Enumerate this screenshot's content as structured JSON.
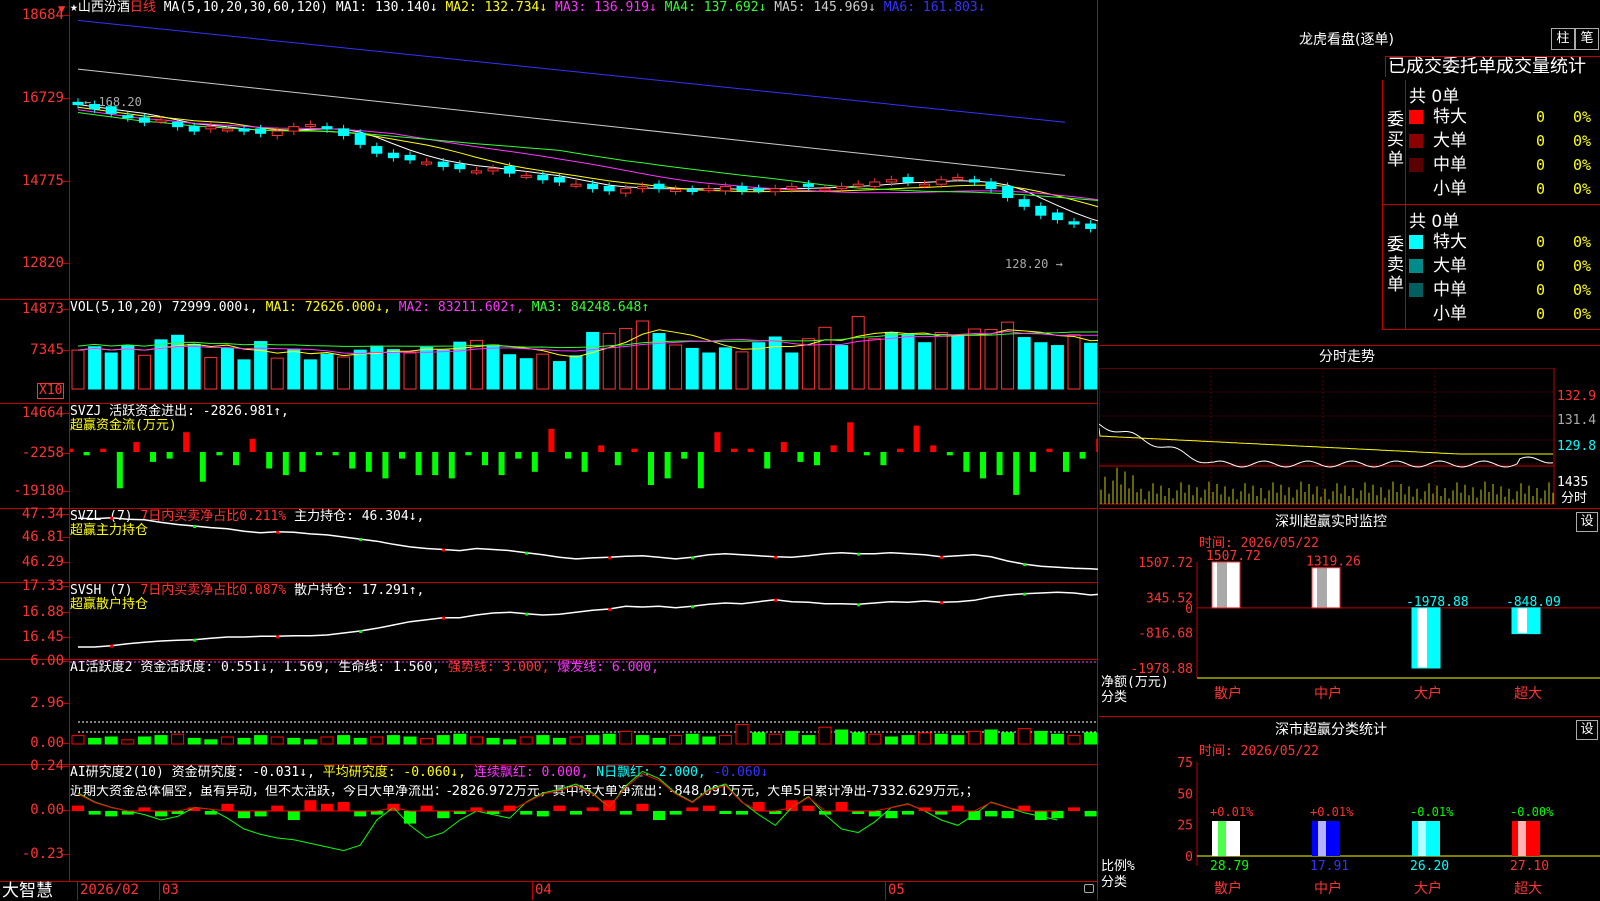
{
  "stock": {
    "name": "山西汾酒",
    "period": "日线",
    "ma_title": "MA(5,10,20,30,60,120)",
    "ma": [
      {
        "label": "MA1: 130.140↓",
        "color": "#ffffff"
      },
      {
        "label": "MA2: 132.734↓",
        "color": "#ffff00"
      },
      {
        "label": "MA3: 136.919↓",
        "color": "#ff33ff"
      },
      {
        "label": "MA4: 137.692↓",
        "color": "#33ff33"
      },
      {
        "label": "MA5: 145.969↓",
        "color": "#cccccc"
      },
      {
        "label": "MA6: 161.803↓",
        "color": "#3333ff"
      }
    ],
    "price_ticks": [
      "18684",
      "16729",
      "14775",
      "12820"
    ],
    "high_label": "168.20",
    "low_label": "128.20"
  },
  "vol": {
    "title": "VOL(5,10,20)",
    "value": "72999.000↓,",
    "ma": [
      {
        "label": "MA1: 72626.000↓,",
        "color": "#ffff00"
      },
      {
        "label": "MA2: 83211.602↑,",
        "color": "#ff33ff"
      },
      {
        "label": "MA3: 84248.648↑",
        "color": "#33ff33"
      }
    ],
    "ticks": [
      "14873",
      "7345"
    ],
    "unit": "X10",
    "values": [
      6.8,
      7.4,
      6.3,
      7.6,
      5.9,
      8.6,
      9.4,
      7.8,
      5.5,
      7.1,
      5.1,
      8.3,
      5.4,
      7.0,
      5.1,
      6.1,
      5.6,
      6.8,
      7.5,
      6.9,
      6.3,
      7.3,
      6.8,
      8.2,
      8.5,
      7.7,
      6.0,
      5.3,
      6.1,
      4.8,
      5.8,
      9.9,
      9.7,
      10.6,
      11.9,
      9.7,
      7.7,
      7.1,
      6.3,
      7.2,
      6.5,
      8.1,
      9.1,
      6.3,
      8.8,
      10.8,
      7.6,
      12.7,
      8.8,
      9.9,
      9.5,
      8.1,
      9.9,
      9.3,
      10.5,
      10.4,
      11.7,
      9.0,
      8.1,
      7.6,
      9.5,
      8.0,
      9.8,
      8.2
    ]
  },
  "svzj": {
    "title": "SVZJ  活跃资金进出: -2826.981↑,",
    "subtitle": "超赢资金流(万元)",
    "ticks": [
      "14664",
      "-2258",
      "-19180"
    ],
    "values": [
      1,
      -1,
      1,
      -11,
      3,
      -3,
      -2,
      6,
      -9,
      -1,
      -4,
      4,
      -5,
      -7,
      -6,
      -1,
      -1,
      -5,
      -6,
      -8,
      -2,
      -7,
      -7,
      -8,
      -1,
      -4,
      -7,
      -2,
      -6,
      7,
      -2,
      -6,
      2,
      -4,
      1,
      -10,
      -8,
      -2,
      -11,
      6,
      1,
      1,
      -5,
      3,
      -3,
      -4,
      2,
      9,
      -1,
      -4,
      1,
      8,
      2,
      -1,
      -6,
      -8,
      -7,
      -13,
      -6,
      1,
      -6,
      -2,
      4,
      -2,
      -2
    ]
  },
  "svzl": {
    "prefix": "SVZL (7)",
    "mid": "7日内买卖净占比0.211%",
    "tail": "主力持仓: 46.304↓,",
    "subtitle": "超赢主力持仓",
    "ticks": [
      "47.34",
      "46.81",
      "46.29"
    ],
    "values": [
      47.3,
      47.29,
      47.31,
      47.28,
      47.27,
      47.22,
      47.18,
      47.15,
      47.12,
      47.1,
      47.05,
      47.02,
      47.04,
      47.03,
      47.0,
      46.98,
      46.94,
      46.9,
      46.86,
      46.8,
      46.75,
      46.72,
      46.7,
      46.68,
      46.72,
      46.7,
      46.68,
      46.64,
      46.6,
      46.55,
      46.52,
      46.54,
      46.55,
      46.57,
      46.58,
      46.55,
      46.52,
      46.55,
      46.6,
      46.62,
      46.6,
      46.58,
      46.56,
      46.55,
      46.58,
      46.62,
      46.64,
      46.62,
      46.62,
      46.64,
      46.62,
      46.6,
      46.56,
      46.58,
      46.6,
      46.56,
      46.48,
      46.42,
      46.38,
      46.36,
      46.34,
      46.33,
      46.31,
      46.32,
      46.3
    ]
  },
  "svsh": {
    "prefix": "SVSH (7)",
    "mid": "7日内买卖净占比0.087%",
    "tail": "散户持仓: 17.291↑,",
    "subtitle": "超赢散户持仓",
    "ticks": [
      "17.33",
      "16.88",
      "16.45"
    ],
    "values": [
      16.46,
      16.46,
      16.48,
      16.51,
      16.53,
      16.55,
      16.56,
      16.57,
      16.59,
      16.61,
      16.61,
      16.62,
      16.62,
      16.63,
      16.63,
      16.64,
      16.67,
      16.7,
      16.74,
      16.79,
      16.84,
      16.87,
      16.9,
      16.9,
      16.94,
      16.97,
      16.98,
      16.96,
      16.94,
      16.95,
      16.98,
      17.01,
      17.03,
      17.07,
      17.06,
      17.07,
      17.05,
      17.07,
      17.1,
      17.12,
      17.11,
      17.14,
      17.17,
      17.14,
      17.13,
      17.11,
      17.11,
      17.1,
      17.12,
      17.14,
      17.13,
      17.15,
      17.13,
      17.14,
      17.16,
      17.21,
      17.24,
      17.26,
      17.27,
      17.28,
      17.27,
      17.24,
      17.26,
      17.29,
      17.29
    ]
  },
  "ai_active": {
    "title": "AI活跃度2",
    "t1": "资金活跃度: 0.551↓, 1.569,",
    "t2": "生命线: 1.560,",
    "t3": "强势线: 3.000,",
    "t4": "爆发线: 6.000,",
    "ticks": [
      "6.00",
      "2.96",
      "0.00"
    ],
    "values": [
      0.6,
      0.4,
      0.5,
      0.3,
      0.5,
      0.6,
      0.7,
      0.4,
      0.3,
      0.5,
      0.4,
      0.6,
      0.5,
      0.4,
      0.3,
      0.5,
      0.6,
      0.4,
      0.5,
      0.6,
      0.5,
      0.4,
      0.6,
      0.7,
      0.5,
      0.4,
      0.3,
      0.5,
      0.6,
      0.4,
      0.5,
      0.6,
      0.7,
      0.9,
      0.6,
      0.4,
      0.6,
      0.7,
      0.5,
      0.6,
      1.4,
      0.8,
      0.7,
      0.9,
      0.6,
      1.2,
      1.0,
      0.8,
      0.7,
      0.5,
      0.6,
      0.8,
      0.7,
      0.6,
      0.9,
      1.0,
      0.8,
      1.1,
      0.9,
      0.7,
      0.6,
      0.8,
      0.7,
      0.5,
      0.55
    ]
  },
  "ai_research": {
    "title": "AI研究度2(10)",
    "t1": "资金研究度: -0.031↓,",
    "t2": "平均研究度: -0.060↓,",
    "t3": "连续飘红: 0.000,",
    "t4": "N日飘红: 2.000,",
    "t5": "-0.060↓",
    "note": "近期大资金总体偏空，虽有异动，但不太活跃，今日大单净流出：-2826.972万元，其中特大单净流出：-848.091万元，大单5日累计净出-7332.629万元，；",
    "ticks": [
      "0.24",
      "0.00",
      "-0.23"
    ],
    "values": [
      0.03,
      -0.02,
      -0.03,
      -0.02,
      0.02,
      -0.03,
      -0.01,
      0.02,
      -0.02,
      0.04,
      -0.04,
      -0.03,
      0.03,
      -0.05,
      0.06,
      0.04,
      0.05,
      -0.03,
      -0.02,
      0.04,
      -0.07,
      0.03,
      -0.04,
      -0.01,
      0.02,
      -0.01,
      0.03,
      -0.02,
      -0.03,
      0.03,
      -0.02,
      0.02,
      0.06,
      -0.02,
      0.04,
      -0.05,
      -0.02,
      0.02,
      0.03,
      -0.01,
      -0.02,
      0.05,
      -0.01,
      0.06,
      0.03,
      -0.02,
      0.05,
      -0.01,
      -0.03,
      -0.04,
      -0.02,
      0.02,
      -0.02,
      0.03,
      -0.05,
      -0.03,
      -0.04,
      0.03,
      -0.05,
      -0.04,
      0.02,
      -0.03,
      0.02,
      -0.02,
      -0.04
    ],
    "line": [
      0.1,
      0.05,
      0.02,
      0.0,
      -0.02,
      -0.05,
      -0.03,
      0.02,
      0.01,
      -0.04,
      -0.1,
      -0.13,
      -0.15,
      -0.16,
      -0.18,
      -0.2,
      -0.22,
      -0.19,
      -0.05,
      0.02,
      -0.08,
      -0.15,
      -0.12,
      -0.05,
      0.0,
      -0.02,
      -0.04,
      0.05,
      0.1,
      0.12,
      0.15,
      0.1,
      0.02,
      0.14,
      0.22,
      0.18,
      0.1,
      0.05,
      0.12,
      0.15,
      0.05,
      -0.02,
      -0.08,
      0.02,
      0.08,
      -0.02,
      -0.1,
      -0.12,
      -0.06,
      0.02,
      0.04,
      0.0,
      -0.05,
      -0.08,
      -0.02,
      0.05,
      0.02,
      -0.01,
      -0.03,
      -0.05
    ]
  },
  "time_axis": {
    "app": "大智慧",
    "labels": [
      "2026/02",
      "03",
      "04",
      "05"
    ]
  },
  "right": {
    "lhb_title": "龙虎看盘(逐单)",
    "btn_zhu": "柱",
    "btn_bi": "笔",
    "header": "已成交委托单成交量统计",
    "buy": {
      "side_label": "委买单",
      "total": "共 0单",
      "rows": [
        {
          "label": "特大",
          "count": "0",
          "pct": "0%",
          "color": "#ff0000"
        },
        {
          "label": "大单",
          "count": "0",
          "pct": "0%",
          "color": "#8b0000"
        },
        {
          "label": "中单",
          "count": "0",
          "pct": "0%",
          "color": "#5a0000"
        },
        {
          "label": "小单",
          "count": "0",
          "pct": "0%",
          "color": "#000000"
        }
      ]
    },
    "sell": {
      "side_label": "委卖单",
      "total": "共 0单",
      "rows": [
        {
          "label": "特大",
          "count": "0",
          "pct": "0%",
          "color": "#00ffff"
        },
        {
          "label": "大单",
          "count": "0",
          "pct": "0%",
          "color": "#008b8b"
        },
        {
          "label": "中单",
          "count": "0",
          "pct": "0%",
          "color": "#006060"
        },
        {
          "label": "小单",
          "count": "0",
          "pct": "0%",
          "color": "#000000"
        }
      ]
    },
    "intraday": {
      "title": "分时走势",
      "ticks": [
        "132.9",
        "131.4",
        "129.8",
        "1435"
      ],
      "unit": "分时"
    },
    "monitor": {
      "title": "深圳超赢实时监控",
      "setting": "设",
      "time": "时间: 2026/05/22",
      "ticks": [
        "1507.72",
        "345.52",
        "0",
        "-816.68",
        "-1978.88"
      ],
      "ylabel": "净额(万元)",
      "xlabel": "分类",
      "categories": [
        "散户",
        "中户",
        "大户",
        "超大"
      ],
      "values": [
        1507.72,
        1319.26,
        -1978.88,
        -848.09
      ],
      "value_labels": [
        "1507.72",
        "1319.26",
        "-1978.88",
        "-848.09"
      ]
    },
    "classify": {
      "title": "深市超赢分类统计",
      "setting": "设",
      "time": "时间: 2026/05/22",
      "ticks": [
        "75",
        "50",
        "25",
        "0"
      ],
      "ylabel": "比例%",
      "xlabel": "分类",
      "categories": [
        "散户",
        "中户",
        "大户",
        "超大"
      ],
      "values": [
        28.79,
        17.91,
        26.2,
        27.1
      ],
      "value_labels": [
        "28.79",
        "17.91",
        "26.20",
        "27.10"
      ],
      "changes": [
        "+0.01%",
        "+0.01%",
        "-0.01%",
        "-0.00%"
      ]
    }
  },
  "chart_data": [
    {
      "type": "bar",
      "title": "深圳超赢实时监控",
      "ylabel": "净额(万元)",
      "xlabel": "分类",
      "categories": [
        "散户",
        "中户",
        "大户",
        "超大"
      ],
      "values": [
        1507.72,
        1319.26,
        -1978.88,
        -848.09
      ],
      "ylim": [
        -1978.88,
        1507.72
      ]
    },
    {
      "type": "bar",
      "title": "深市超赢分类统计",
      "ylabel": "比例%",
      "xlabel": "分类",
      "categories": [
        "散户",
        "中户",
        "大户",
        "超大"
      ],
      "values": [
        28.79,
        17.91,
        26.2,
        27.1
      ],
      "ylim": [
        0,
        75
      ]
    }
  ]
}
